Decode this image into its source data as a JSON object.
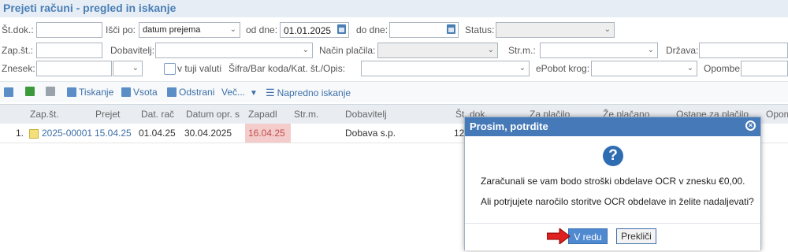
{
  "page": {
    "title": "Prejeti računi - pregled in iskanje"
  },
  "filters": {
    "st_dok_label": "Št.dok.:",
    "isci_po_label": "Išči po:",
    "isci_po_value": "datum prejema",
    "od_dne_label": "od dne:",
    "od_dne_value": "01.01.2025",
    "do_dne_label": "do dne:",
    "do_dne_value": "",
    "status_label": "Status:",
    "zap_st_label": "Zap.št.:",
    "dobavitelj_label": "Dobavitelj:",
    "nacin_placila_label": "Način plačila:",
    "str_m_label": "Str.m.:",
    "drzava_label": "Država:",
    "znesek_label": "Znesek:",
    "v_tuji_valuti_label": "v tuji valuti",
    "sifra_label": "Šifra/Bar koda/Kat. št./Opis:",
    "epobot_label": "ePobot krog:",
    "opombe_label": "Opombe:"
  },
  "toolbar": {
    "print_label": "Tiskanje",
    "sum_label": "Vsota",
    "delete_label": "Odstrani",
    "more_label": "Več...",
    "advanced_label": "Napredno iskanje"
  },
  "grid": {
    "columns": [
      "Zap.št.",
      "Prejet",
      "Dat. rač",
      "Datum opr. s",
      "Zapadl",
      "Str.m.",
      "Dobavitelj",
      "Št. dok.",
      "Za plačilo",
      "Že plačano",
      "Ostane za plačilo",
      "Opom"
    ],
    "rows": [
      {
        "num": "1.",
        "zap_st": "2025-00001",
        "prejet": "15.04.25",
        "dat_rac": "01.04.25",
        "datum_opr": "30.04.2025",
        "zapadl": "16.04.25",
        "str_m": "",
        "dobavitelj": "Dobava s.p.",
        "st_dok": "12"
      }
    ]
  },
  "modal": {
    "title": "Prosim, potrdite",
    "line1": "Zaračunali se vam bodo stroški obdelave OCR v znesku €0,00.",
    "line2": "Ali potrjujete naročilo storitve OCR obdelave in želite nadaljevati?",
    "ok_label": "V redu",
    "cancel_label": "Prekliči"
  },
  "colors": {
    "accent": "#4679b8",
    "overdue": "#f4cccc",
    "arrow": "#e02020"
  }
}
